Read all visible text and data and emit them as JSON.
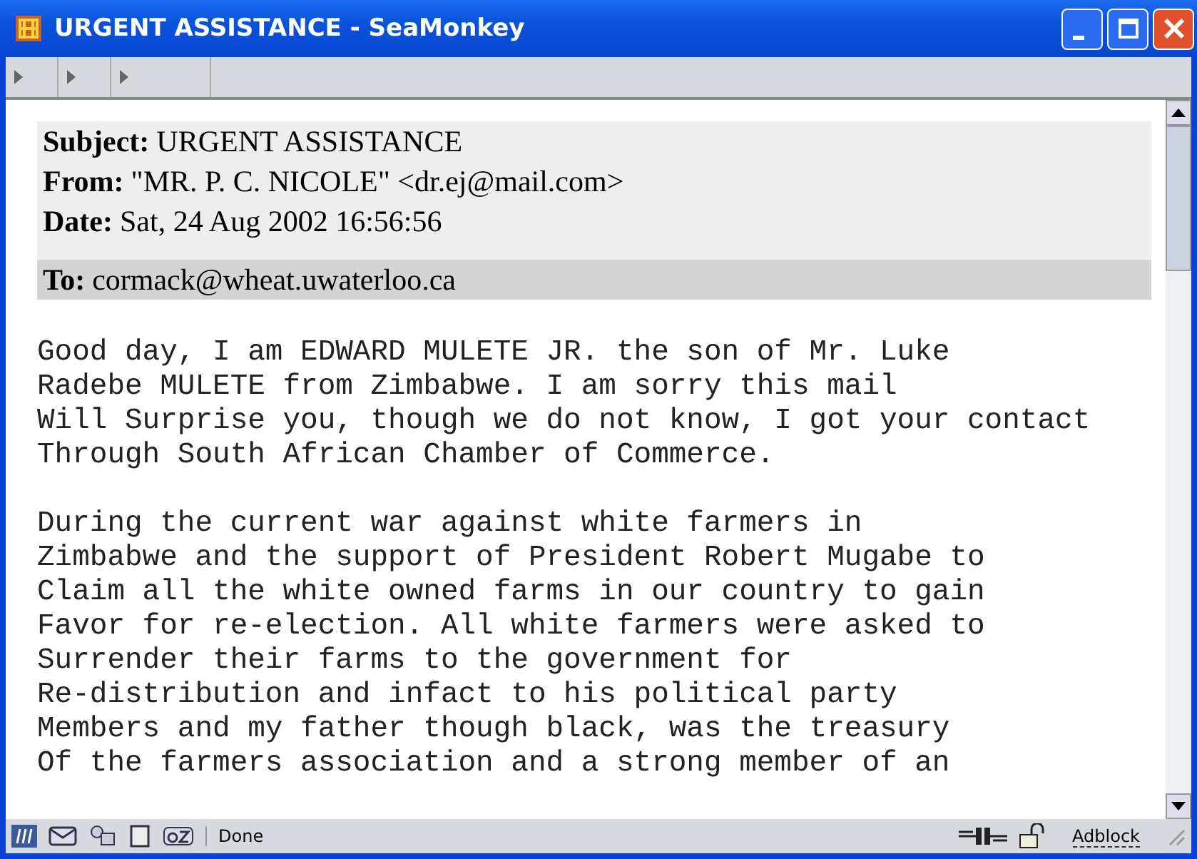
{
  "window": {
    "title": "URGENT ASSISTANCE - SeaMonkey"
  },
  "headers": [
    {
      "label": "Subject:",
      "value": "URGENT ASSISTANCE",
      "kind": "plain"
    },
    {
      "label": "From:",
      "value": "\"MR. P. C. NICOLE\" <dr.ej@mail.com>",
      "kind": "plain"
    },
    {
      "label": "Date:",
      "value": "Sat, 24 Aug 2002 16:56:56",
      "kind": "plain"
    },
    {
      "label": "To:",
      "value": "cormack@wheat.uwaterloo.ca",
      "kind": "shaded"
    }
  ],
  "paragraphs": [
    [
      "Good day, I am EDWARD MULETE JR. the son of Mr. Luke",
      "Radebe MULETE from Zimbabwe. I am sorry this mail",
      "Will Surprise you, though we do not know, I got your contact",
      "Through South African Chamber of Commerce."
    ],
    [
      "During the current war against white farmers in",
      "Zimbabwe and the support of President Robert Mugabe to",
      "Claim all the white owned farms in our country to gain",
      "Favor for re-election. All white farmers were asked to",
      "Surrender their farms to the government for",
      "Re-distribution and infact to his political party",
      "Members and my father though black, was the treasury",
      "Of the farmers association and a strong member of an"
    ]
  ],
  "status_bar": {
    "status": "Done",
    "adblock": "Adblock"
  }
}
